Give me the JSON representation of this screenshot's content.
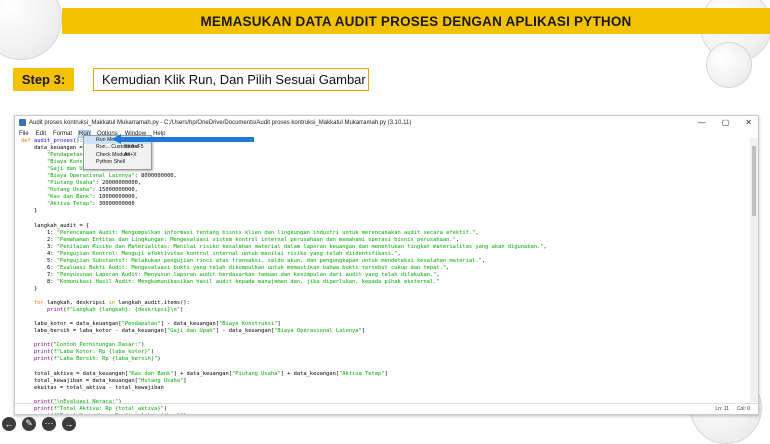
{
  "slide": {
    "banner_title": "MEMASUKAN DATA AUDIT PROSES DENGAN APLIKASI PYTHON",
    "step_label": "Step 3:",
    "instruction": "Kemudian Klik Run,  Dan Pilih Sesuai Gambar"
  },
  "window": {
    "title": "Audit proses kontruksi_Makkatul Mukarramah.py - C:/Users/hp/OneDrive/Documents/Audit proses kontruksi_Makkatul Mukarramah.py (3.10.11)",
    "controls": [
      "—",
      "▢",
      "✕"
    ],
    "menu": [
      "File",
      "Edit",
      "Format",
      "Run",
      "Options",
      "Window",
      "Help"
    ],
    "status": {
      "line": "Ln: 11",
      "col": "Col: 0"
    }
  },
  "run_menu": [
    {
      "label": "Run Module",
      "shortcut": "F5"
    },
    {
      "label": "Run... Customized",
      "shortcut": "Shift+F5"
    },
    {
      "label": "Check Module",
      "shortcut": "Alt+X"
    },
    {
      "label": "Python Shell",
      "shortcut": ""
    }
  ],
  "code_lines": [
    "def audit_proses():",
    "    data_keuangan = {",
    "        \"Pendapatan\": ",
    "        \"Biaya Konstruksi\": ",
    "        \"Gaji dan Upah\": ,",
    "        \"Biaya Operasional Lainnya\": 8000000000,",
    "        \"Piutang Usaha\": 20000000000,",
    "        \"Hutang Usaha\": 15000000000,",
    "        \"Kas dan Bank\": 10000000000,",
    "        \"Aktiva Tetap\": 30000000000",
    "    }",
    "",
    "    langkah_audit = {",
    "        1: \"Perencanaan Audit: Mengumpulkan informasi tentang bisnis klien dan lingkungan industri untuk merencanakan audit secara efektif.\",",
    "        2: \"Pemahaman Entitas dan Lingkungan: Mengevaluasi sistem kontrol internal perusahaan dan memahami operasi bisnis perusahaan.\",",
    "        3: \"Penilaian Risiko dan Materialitas: Menilai risiko kesalahan material dalam laporan keuangan dan menentukan tingkat materialitas yang akan digunakan.\",",
    "        4: \"Pengujian Kontrol: Menguji efektivitas kontrol internal untuk menilai risiko yang telah diidentifikasi.\",",
    "        5: \"Pengujian Substantif: Melakukan pengujian rinci atas transaksi, saldo akun, dan pengungkapan untuk mendeteksi kesalahan material.\",",
    "        6: \"Evaluasi Bukti Audit: Mengevaluasi bukti yang telah dikumpulkan untuk memastikan bahwa bukti tersebut cukup dan tepat.\",",
    "        7: \"Penyusunan Laporan Audit: Menyusun laporan audit berdasarkan temuan dan kesimpulan dari audit yang telah dilakukan.\",",
    "        8: \"Komunikasi Hasil Audit: Mengkomunikasikan hasil audit kepada manajemen dan, jika diperlukan, kepada pihak eksternal.\"",
    "    }",
    "",
    "    for langkah, deskripsi in langkah_audit.items():",
    "        print(f\"Langkah {langkah}: {deskripsi}\\n\")",
    "",
    "    laba_kotor = data_keuangan[\"Pendapatan\"] - data_keuangan[\"Biaya Konstruksi\"]",
    "    laba_bersih = laba_kotor - data_keuangan[\"Gaji dan Upah\"] - data_keuangan[\"Biaya Operasional Lainnya\"]",
    "",
    "    print(\"Contoh Perhitungan Dasar:\")",
    "    print(f\"Laba Kotor: Rp {laba_kotor}\")",
    "    print(f\"Laba Bersih: Rp {laba_bersih}\")",
    "",
    "    total_aktiva = data_keuangan[\"Kas dan Bank\"] + data_keuangan[\"Piutang Usaha\"] + data_keuangan[\"Aktiva Tetap\"]",
    "    total_kewajiban = data_keuangan[\"Hutang Usaha\"]",
    "    ekuitas = total_aktiva - total_kewajiban",
    "",
    "    print(\"\\nEvaluasi Neraca:\")",
    "    print(f\"Total Aktiva: Rp {total_aktiva}\")",
    "    print(f\"Total Kewajiban: Rp {total_kewajiban}\")",
    "    print(f\"Ekuitas: Rp {ekuitas}\")"
  ],
  "nav_icons": [
    "back-icon",
    "pen-icon",
    "more-icon",
    "forward-icon"
  ]
}
